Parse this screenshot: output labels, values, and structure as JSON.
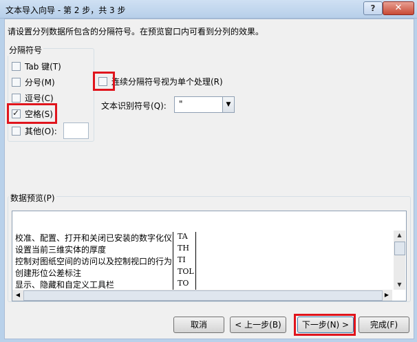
{
  "window": {
    "title": "文本导入向导 - 第 2 步，共 3 步",
    "help": "?",
    "close": "✕"
  },
  "instruction": "请设置分列数据所包含的分隔符号。在预览窗口内可看到分列的效果。",
  "delimiters": {
    "legend": "分隔符号",
    "items": [
      {
        "label": "Tab 键(T)",
        "checked": false
      },
      {
        "label": "分号(M)",
        "checked": false
      },
      {
        "label": "逗号(C)",
        "checked": false
      },
      {
        "label": "空格(S)",
        "checked": true
      },
      {
        "label": "其他(O):",
        "checked": false
      }
    ]
  },
  "consecutive": {
    "label": "连续分隔符号视为单个处理(R)",
    "checked": false
  },
  "text_qualifier": {
    "label": "文本识别符号(Q):",
    "value": "\""
  },
  "preview": {
    "legend": "数据预览(P)",
    "rows": [
      {
        "col1": "校准、配置、打开和关闭已安装的数字化仪",
        "col2": "TA"
      },
      {
        "col1": "设置当前三维实体的厚度",
        "col2": "TH"
      },
      {
        "col1": "控制对图纸空间的访问以及控制视口的行为",
        "col2": "TI"
      },
      {
        "col1": "创建形位公差标注",
        "col2": "TOL"
      },
      {
        "col1": "显示、隐藏和自定义工具栏",
        "col2": "TO"
      }
    ]
  },
  "buttons": {
    "cancel": "取消",
    "back": "< 上一步(B)",
    "next": "下一步(N) >",
    "finish": "完成(F)"
  },
  "colors": {
    "highlight": "#e0141c"
  }
}
